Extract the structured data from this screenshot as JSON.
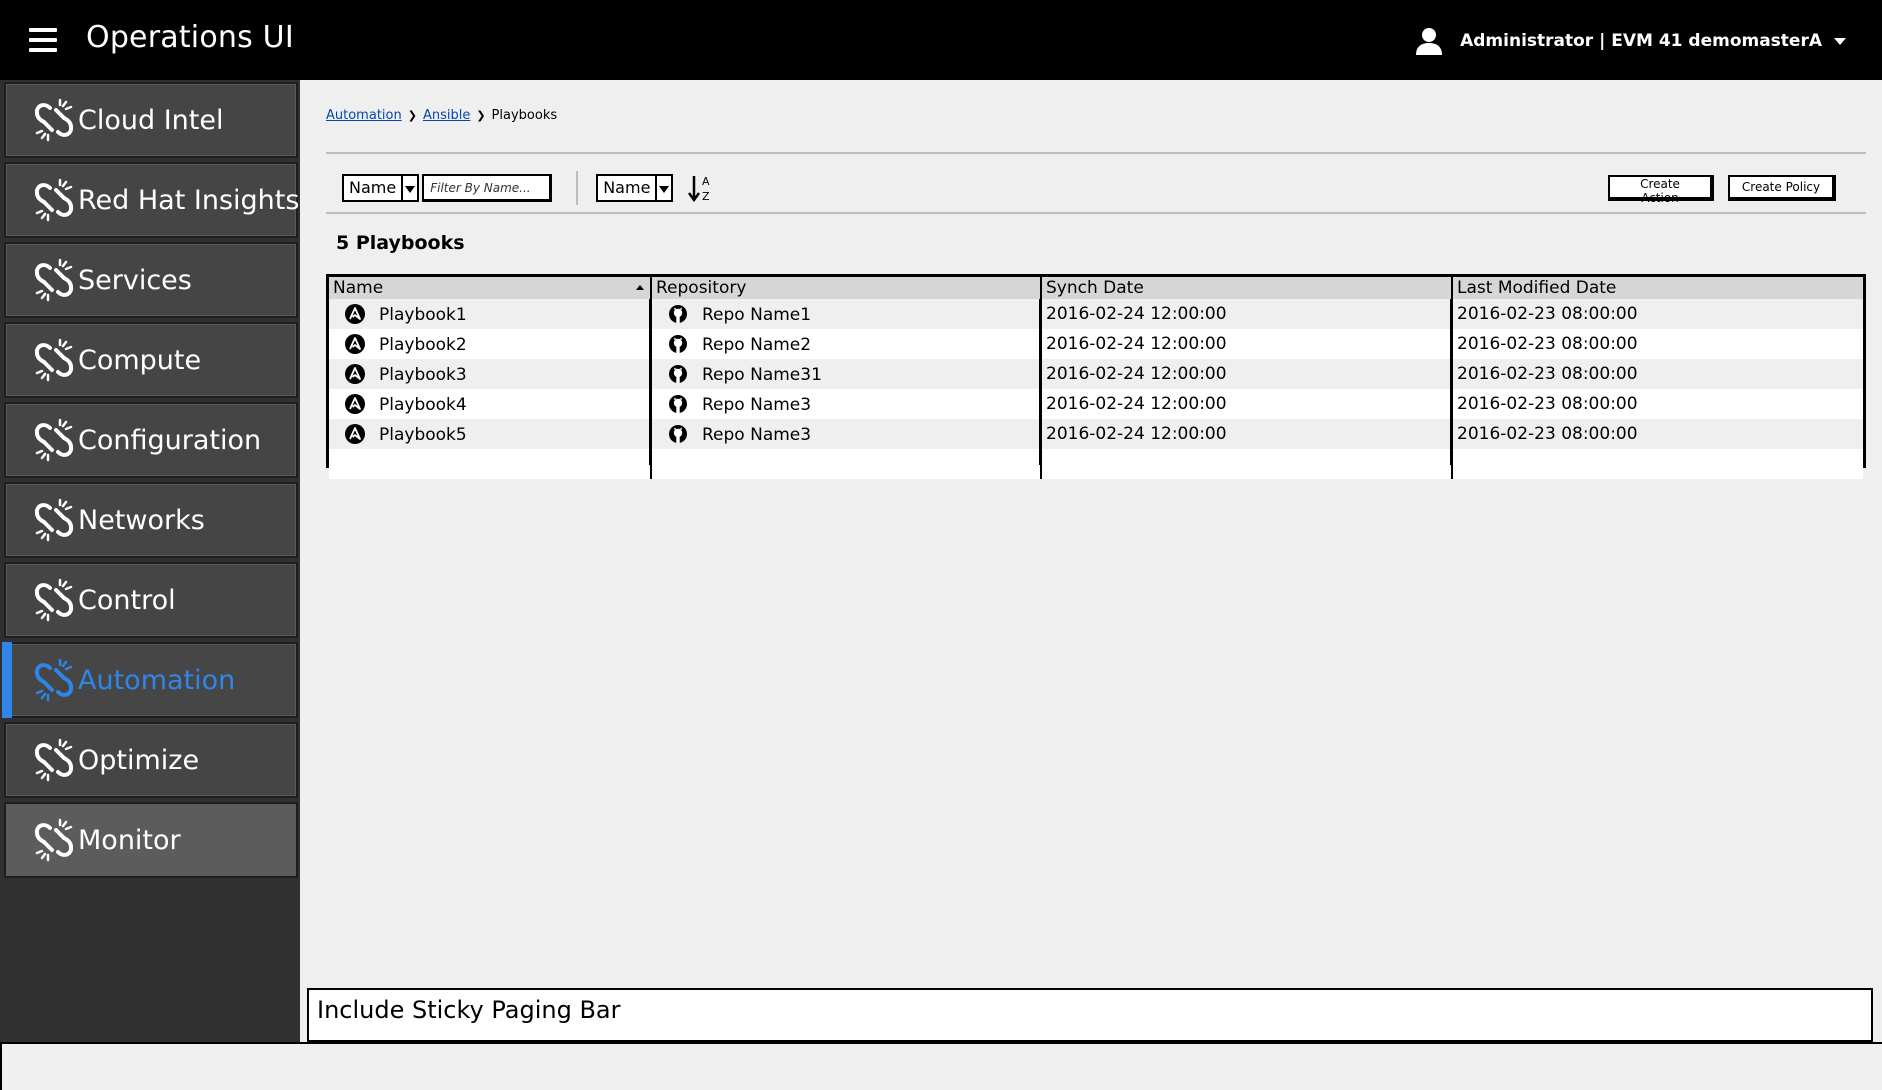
{
  "header": {
    "title": "Operations UI",
    "user_label": "Administrator | EVM 41 demomasterA"
  },
  "sidebar": {
    "items": [
      {
        "label": "Cloud Intel"
      },
      {
        "label": "Red Hat Insights"
      },
      {
        "label": "Services"
      },
      {
        "label": "Compute"
      },
      {
        "label": "Configuration"
      },
      {
        "label": "Networks"
      },
      {
        "label": "Control"
      },
      {
        "label": "Automation",
        "active": true
      },
      {
        "label": "Optimize"
      },
      {
        "label": "Monitor"
      }
    ]
  },
  "breadcrumb": {
    "items": [
      "Automation",
      "Ansible",
      "Playbooks"
    ]
  },
  "toolbar": {
    "filter_field": "Name",
    "filter_placeholder": "Filter By Name...",
    "sort_field": "Name",
    "create_action_label": "Create Action",
    "create_policy_label": "Create Policy"
  },
  "main": {
    "count_title": "5 Playbooks"
  },
  "table": {
    "headers": [
      "Name",
      "Repository",
      "Synch Date",
      "Last Modified Date"
    ],
    "rows": [
      {
        "name": "Playbook1",
        "repo": "Repo Name1",
        "synch": "2016-02-24 12:00:00",
        "modified": "2016-02-23 08:00:00"
      },
      {
        "name": "Playbook2",
        "repo": "Repo Name2",
        "synch": "2016-02-24 12:00:00",
        "modified": "2016-02-23 08:00:00"
      },
      {
        "name": "Playbook3",
        "repo": "Repo Name31",
        "synch": "2016-02-24 12:00:00",
        "modified": "2016-02-23 08:00:00"
      },
      {
        "name": "Playbook4",
        "repo": "Repo Name3",
        "synch": "2016-02-24 12:00:00",
        "modified": "2016-02-23 08:00:00"
      },
      {
        "name": "Playbook5",
        "repo": "Repo Name3",
        "synch": "2016-02-24 12:00:00",
        "modified": "2016-02-23 08:00:00"
      }
    ]
  },
  "paging": {
    "note": "Include Sticky Paging Bar"
  },
  "colors": {
    "accent": "#2f86e8",
    "topbar": "#000000",
    "sidebar": "#303030"
  },
  "icons": {
    "nav": "chain-link-icon",
    "playbook": "ansible-icon",
    "repo": "github-icon"
  }
}
